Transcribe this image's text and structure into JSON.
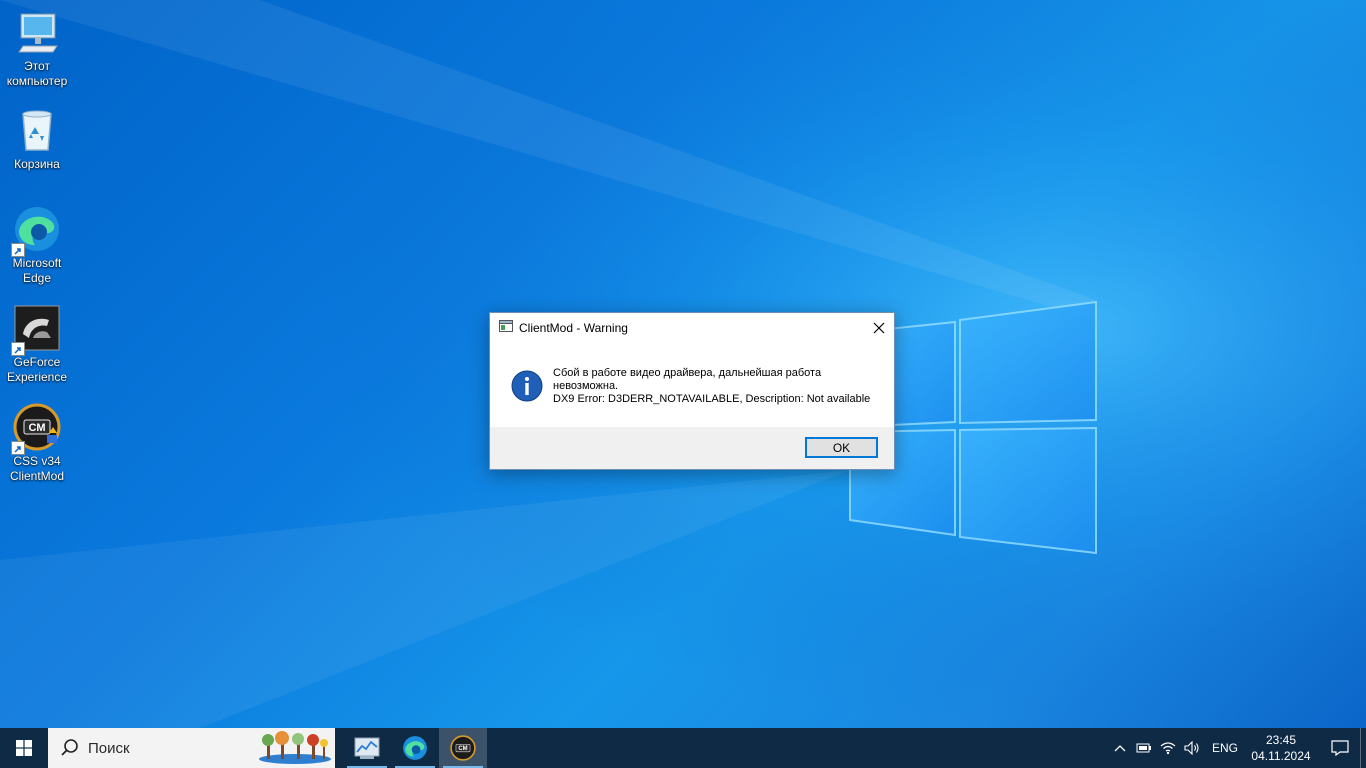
{
  "desktop": {
    "icons": [
      {
        "label": "Этот компьютер",
        "icon": "computer-icon"
      },
      {
        "label": "Корзина",
        "icon": "recycle-bin-icon"
      },
      {
        "label": "Microsoft Edge",
        "icon": "edge-icon"
      },
      {
        "label": "GeForce Experience",
        "icon": "geforce-experience-icon"
      },
      {
        "label": "CSS v34 ClientMod",
        "icon": "clientmod-icon"
      }
    ]
  },
  "dialog": {
    "title": "ClientMod - Warning",
    "message_line1": "Сбой в работе видео драйвера, дальнейшая работа невозможна.",
    "message_line2": "DX9 Error: D3DERR_NOTAVAILABLE, Description: Not available",
    "ok_label": "OK"
  },
  "taskbar": {
    "search_placeholder": "Поиск",
    "apps": [
      {
        "name": "task-manager-icon",
        "running": true
      },
      {
        "name": "edge-icon",
        "running": true
      },
      {
        "name": "clientmod-icon",
        "running": true,
        "active": true
      }
    ],
    "tray": {
      "language": "ENG",
      "time": "23:45",
      "date": "04.11.2024"
    }
  },
  "colors": {
    "wallpaper_blue": "#0a79dd",
    "taskbar_bg": "#0f2a45",
    "accent": "#0078d7"
  }
}
